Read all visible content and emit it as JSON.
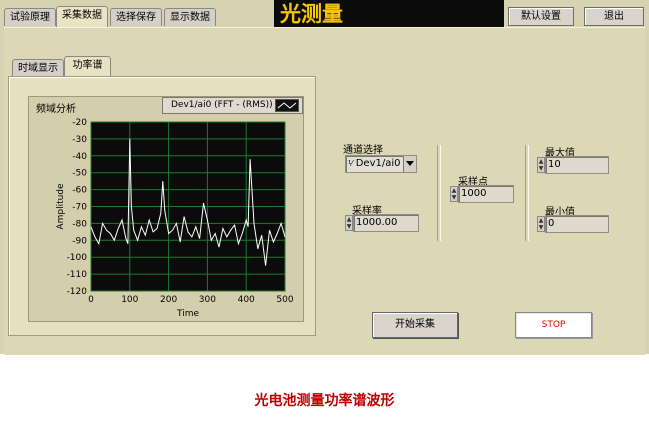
{
  "top_tabs": [
    {
      "label": "试验原理"
    },
    {
      "label": "采集数据"
    },
    {
      "label": "选择保存"
    },
    {
      "label": "显示数据"
    }
  ],
  "title": "光测量",
  "buttons": {
    "defaults": "默认设置",
    "exit": "退出",
    "start": "开始采集",
    "stop": "STOP"
  },
  "sub_tabs": [
    {
      "label": "时域显示"
    },
    {
      "label": "功率谱"
    }
  ],
  "chart_label": "频域分析",
  "plot_legend": "Dev1/ai0 (FFT - (RMS))",
  "controls": {
    "channel_label": "通道选择",
    "channel_prefix": "⅟",
    "channel_value": "Dev1/ai0",
    "rate_label": "采样率",
    "rate_value": "1000.00",
    "points_label": "采样点",
    "points_value": "1000",
    "max_label": "最大值",
    "max_value": "10",
    "min_label": "最小值",
    "min_value": "0"
  },
  "caption": "光电池测量功率谱波形",
  "colors": {
    "plot_bg": "#0b0b0b",
    "grid": "#1f7a2e",
    "trace": "#ffffff",
    "title_bg": "#0b0b0b",
    "title_fg": "#f5c400",
    "caption": "#c00000",
    "stop_text": "#e00000"
  },
  "chart_data": {
    "type": "line",
    "xlabel": "Time",
    "ylabel": "Amplitude",
    "xlim": [
      0,
      500
    ],
    "ylim": [
      -120,
      -20
    ],
    "x_ticks": [
      0,
      100,
      200,
      300,
      400,
      500
    ],
    "y_ticks": [
      -20,
      -30,
      -40,
      -50,
      -60,
      -70,
      -80,
      -90,
      -100,
      -110,
      -120
    ],
    "grid": true,
    "series": [
      {
        "x": [
          0,
          10,
          20,
          30,
          40,
          50,
          60,
          70,
          80,
          90,
          95,
          100,
          104,
          110,
          120,
          130,
          140,
          150,
          160,
          170,
          180,
          185,
          190,
          200,
          210,
          220,
          230,
          240,
          250,
          260,
          270,
          280,
          290,
          300,
          310,
          320,
          330,
          340,
          350,
          360,
          370,
          380,
          390,
          400,
          405,
          410,
          420,
          430,
          440,
          450,
          460,
          470,
          480,
          490,
          500
        ],
        "y": [
          -82,
          -88,
          -92,
          -80,
          -84,
          -86,
          -90,
          -83,
          -78,
          -89,
          -92,
          -30,
          -70,
          -84,
          -90,
          -82,
          -87,
          -78,
          -85,
          -83,
          -74,
          -55,
          -72,
          -86,
          -84,
          -80,
          -91,
          -76,
          -85,
          -88,
          -82,
          -89,
          -68,
          -78,
          -90,
          -86,
          -94,
          -83,
          -88,
          -84,
          -81,
          -92,
          -86,
          -78,
          -82,
          -42,
          -80,
          -95,
          -87,
          -105,
          -84,
          -91,
          -86,
          -80,
          -88
        ]
      }
    ]
  }
}
